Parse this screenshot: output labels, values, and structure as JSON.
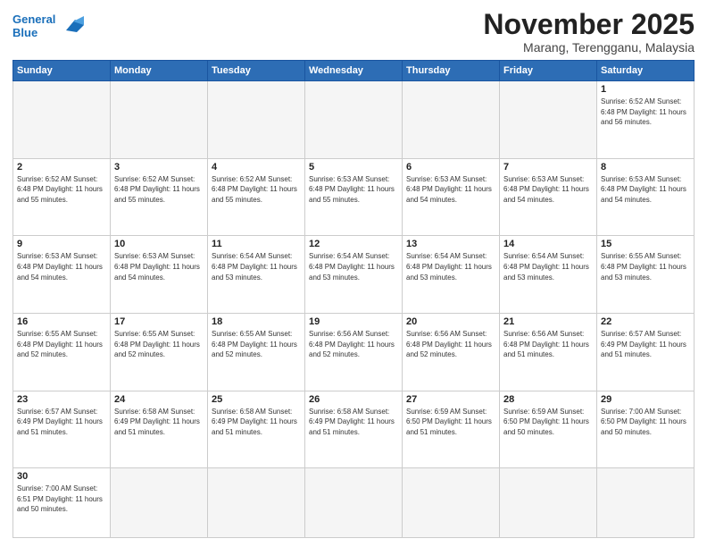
{
  "header": {
    "logo_general": "General",
    "logo_blue": "Blue",
    "month_title": "November 2025",
    "location": "Marang, Terengganu, Malaysia"
  },
  "weekdays": [
    "Sunday",
    "Monday",
    "Tuesday",
    "Wednesday",
    "Thursday",
    "Friday",
    "Saturday"
  ],
  "weeks": [
    [
      {
        "day": "",
        "info": ""
      },
      {
        "day": "",
        "info": ""
      },
      {
        "day": "",
        "info": ""
      },
      {
        "day": "",
        "info": ""
      },
      {
        "day": "",
        "info": ""
      },
      {
        "day": "",
        "info": ""
      },
      {
        "day": "1",
        "info": "Sunrise: 6:52 AM\nSunset: 6:48 PM\nDaylight: 11 hours\nand 56 minutes."
      }
    ],
    [
      {
        "day": "2",
        "info": "Sunrise: 6:52 AM\nSunset: 6:48 PM\nDaylight: 11 hours\nand 55 minutes."
      },
      {
        "day": "3",
        "info": "Sunrise: 6:52 AM\nSunset: 6:48 PM\nDaylight: 11 hours\nand 55 minutes."
      },
      {
        "day": "4",
        "info": "Sunrise: 6:52 AM\nSunset: 6:48 PM\nDaylight: 11 hours\nand 55 minutes."
      },
      {
        "day": "5",
        "info": "Sunrise: 6:53 AM\nSunset: 6:48 PM\nDaylight: 11 hours\nand 55 minutes."
      },
      {
        "day": "6",
        "info": "Sunrise: 6:53 AM\nSunset: 6:48 PM\nDaylight: 11 hours\nand 54 minutes."
      },
      {
        "day": "7",
        "info": "Sunrise: 6:53 AM\nSunset: 6:48 PM\nDaylight: 11 hours\nand 54 minutes."
      },
      {
        "day": "8",
        "info": "Sunrise: 6:53 AM\nSunset: 6:48 PM\nDaylight: 11 hours\nand 54 minutes."
      }
    ],
    [
      {
        "day": "9",
        "info": "Sunrise: 6:53 AM\nSunset: 6:48 PM\nDaylight: 11 hours\nand 54 minutes."
      },
      {
        "day": "10",
        "info": "Sunrise: 6:53 AM\nSunset: 6:48 PM\nDaylight: 11 hours\nand 54 minutes."
      },
      {
        "day": "11",
        "info": "Sunrise: 6:54 AM\nSunset: 6:48 PM\nDaylight: 11 hours\nand 53 minutes."
      },
      {
        "day": "12",
        "info": "Sunrise: 6:54 AM\nSunset: 6:48 PM\nDaylight: 11 hours\nand 53 minutes."
      },
      {
        "day": "13",
        "info": "Sunrise: 6:54 AM\nSunset: 6:48 PM\nDaylight: 11 hours\nand 53 minutes."
      },
      {
        "day": "14",
        "info": "Sunrise: 6:54 AM\nSunset: 6:48 PM\nDaylight: 11 hours\nand 53 minutes."
      },
      {
        "day": "15",
        "info": "Sunrise: 6:55 AM\nSunset: 6:48 PM\nDaylight: 11 hours\nand 53 minutes."
      }
    ],
    [
      {
        "day": "16",
        "info": "Sunrise: 6:55 AM\nSunset: 6:48 PM\nDaylight: 11 hours\nand 52 minutes."
      },
      {
        "day": "17",
        "info": "Sunrise: 6:55 AM\nSunset: 6:48 PM\nDaylight: 11 hours\nand 52 minutes."
      },
      {
        "day": "18",
        "info": "Sunrise: 6:55 AM\nSunset: 6:48 PM\nDaylight: 11 hours\nand 52 minutes."
      },
      {
        "day": "19",
        "info": "Sunrise: 6:56 AM\nSunset: 6:48 PM\nDaylight: 11 hours\nand 52 minutes."
      },
      {
        "day": "20",
        "info": "Sunrise: 6:56 AM\nSunset: 6:48 PM\nDaylight: 11 hours\nand 52 minutes."
      },
      {
        "day": "21",
        "info": "Sunrise: 6:56 AM\nSunset: 6:48 PM\nDaylight: 11 hours\nand 51 minutes."
      },
      {
        "day": "22",
        "info": "Sunrise: 6:57 AM\nSunset: 6:49 PM\nDaylight: 11 hours\nand 51 minutes."
      }
    ],
    [
      {
        "day": "23",
        "info": "Sunrise: 6:57 AM\nSunset: 6:49 PM\nDaylight: 11 hours\nand 51 minutes."
      },
      {
        "day": "24",
        "info": "Sunrise: 6:58 AM\nSunset: 6:49 PM\nDaylight: 11 hours\nand 51 minutes."
      },
      {
        "day": "25",
        "info": "Sunrise: 6:58 AM\nSunset: 6:49 PM\nDaylight: 11 hours\nand 51 minutes."
      },
      {
        "day": "26",
        "info": "Sunrise: 6:58 AM\nSunset: 6:49 PM\nDaylight: 11 hours\nand 51 minutes."
      },
      {
        "day": "27",
        "info": "Sunrise: 6:59 AM\nSunset: 6:50 PM\nDaylight: 11 hours\nand 51 minutes."
      },
      {
        "day": "28",
        "info": "Sunrise: 6:59 AM\nSunset: 6:50 PM\nDaylight: 11 hours\nand 50 minutes."
      },
      {
        "day": "29",
        "info": "Sunrise: 7:00 AM\nSunset: 6:50 PM\nDaylight: 11 hours\nand 50 minutes."
      }
    ],
    [
      {
        "day": "30",
        "info": "Sunrise: 7:00 AM\nSunset: 6:51 PM\nDaylight: 11 hours\nand 50 minutes."
      },
      {
        "day": "",
        "info": ""
      },
      {
        "day": "",
        "info": ""
      },
      {
        "day": "",
        "info": ""
      },
      {
        "day": "",
        "info": ""
      },
      {
        "day": "",
        "info": ""
      },
      {
        "day": "",
        "info": ""
      }
    ]
  ]
}
